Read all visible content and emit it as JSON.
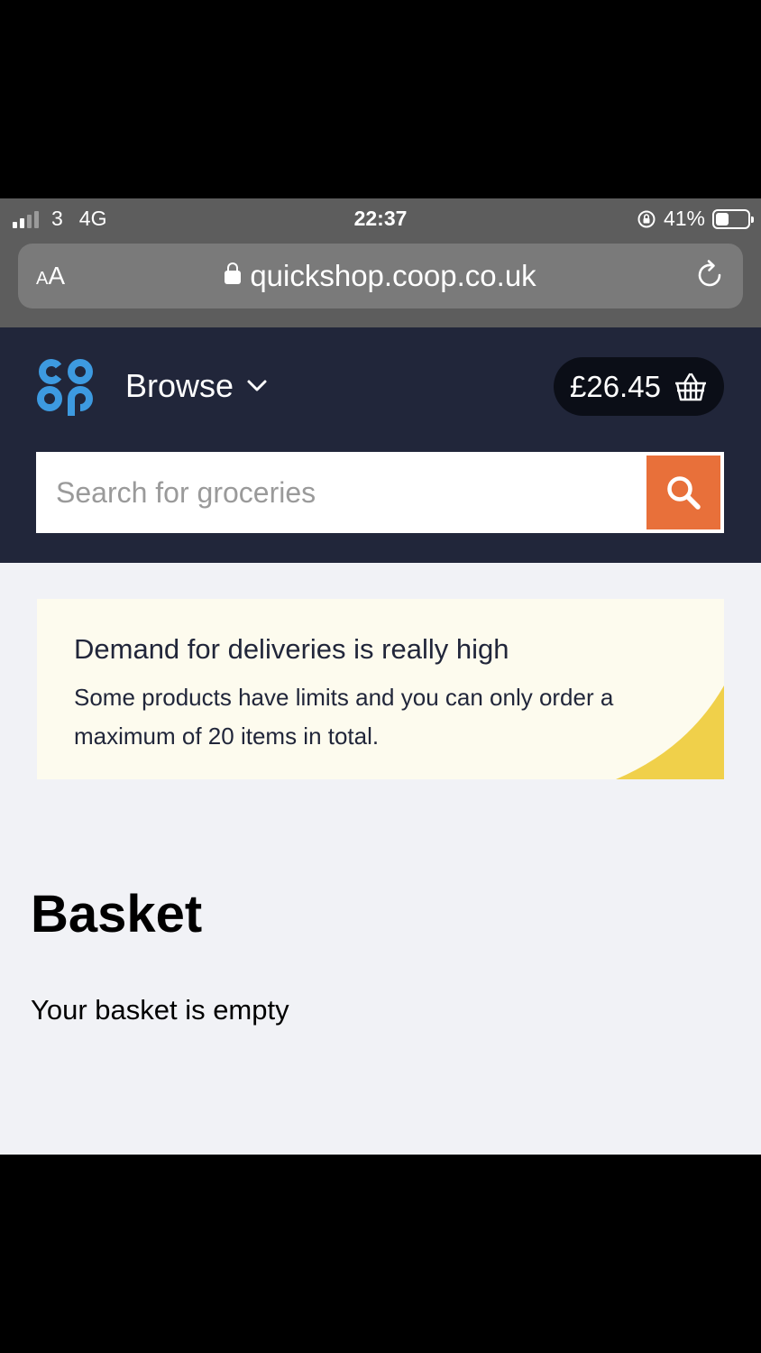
{
  "status_bar": {
    "carrier": "3",
    "network": "4G",
    "time": "22:37",
    "battery": "41%",
    "battery_level": 0.41,
    "icons": [
      "signal-bars-icon",
      "orientation-lock-icon",
      "battery-icon"
    ]
  },
  "browser": {
    "text_size_label": "AA",
    "url": "quickshop.coop.co.uk",
    "icons": [
      "lock-icon",
      "reload-icon"
    ]
  },
  "header": {
    "logo_text": "co op",
    "browse_label": "Browse",
    "basket_total": "£26.45",
    "icons": [
      "chevron-down-icon",
      "basket-icon"
    ],
    "colors": {
      "background": "#21263a",
      "logo": "#3d9ae0",
      "pill": "#0b0e17"
    }
  },
  "search": {
    "placeholder": "Search for groceries",
    "value": "",
    "button_color": "#e8703a",
    "icon": "search-icon"
  },
  "notice": {
    "title": "Demand for deliveries is really high",
    "body": "Some products have limits and you can only order a maximum of 20 items in total.",
    "accent_color": "#f0d04a"
  },
  "basket": {
    "title": "Basket",
    "empty_message": "Your basket is empty"
  }
}
